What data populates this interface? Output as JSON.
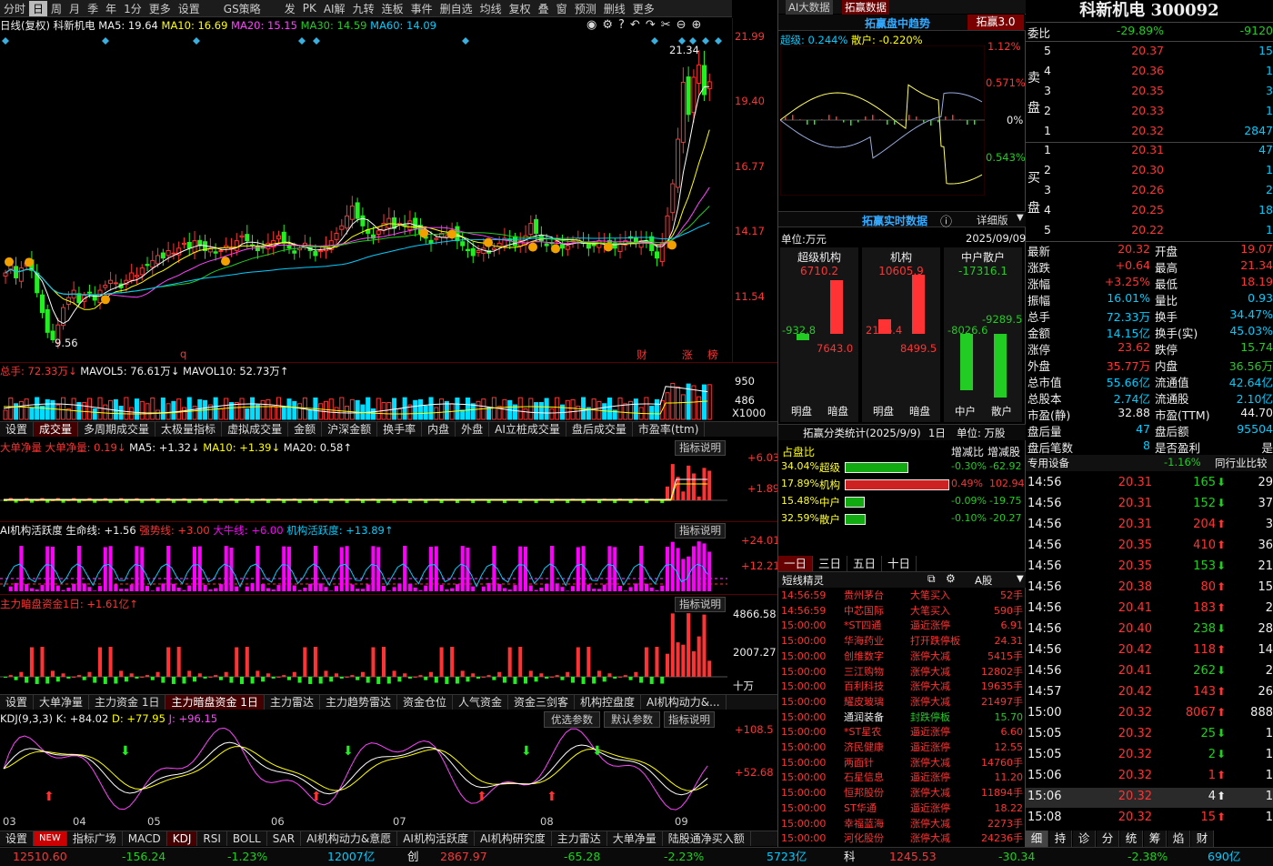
{
  "toolbar": {
    "items": [
      "分时",
      "日",
      "周",
      "月",
      "季",
      "年",
      "1分",
      "更多",
      "设置",
      "GS策略",
      "发",
      "PK",
      "AI解",
      "九转",
      "连板",
      "事件",
      "删自选",
      "均线",
      "复权",
      "叠",
      "窗",
      "预测",
      "删线",
      "更多"
    ],
    "active": "日"
  },
  "chart_header": {
    "mode": "日线(复权)",
    "name": "科新机电",
    "ma5": "MA5: 19.64",
    "ma10": "MA10: 16.69",
    "ma20": "MA20: 15.15",
    "ma30": "MA30: 14.59",
    "ma60": "MA60: 14.09"
  },
  "price_axis": [
    "21.99",
    "19.40",
    "16.77",
    "14.17",
    "11.54"
  ],
  "price_marks": {
    "high": "21.34",
    "low": "9.56",
    "bottom_labels": [
      "q",
      "财",
      "涨",
      "榜"
    ]
  },
  "volume": {
    "header": {
      "total": "总手: 72.33万↓",
      "mavol5": "MAVOL5: 76.61万↓",
      "mavol10": "MAVOL10: 52.73万↑"
    },
    "axis": [
      "950",
      "486",
      "X1000"
    ]
  },
  "tabs1": [
    "设置",
    "成交量",
    "多周期成交量",
    "太极量指标",
    "虚拟成交量",
    "金额",
    "沪深金额",
    "换手率",
    "内盘",
    "外盘",
    "AI立桩成交量",
    "盘后成交量",
    "市盈率(ttm)"
  ],
  "ind1": {
    "title": "大单净量",
    "label": "大单净量: 0.19↓",
    "ma5": "MA5: +1.32↓",
    "ma10": "MA10: +1.39↓",
    "ma20": "MA20: 0.58↑",
    "btn": "指标说明",
    "axis": [
      "+6.03",
      "+1.89"
    ]
  },
  "ind2": {
    "title": "AI机构活跃度",
    "life": "生命线: +1.56",
    "strong": "强势线: +3.00",
    "bull": "大牛线: +6.00",
    "act": "机构活跃度: +13.89↑",
    "btn": "指标说明",
    "axis": [
      "+24.01",
      "+12.21"
    ]
  },
  "ind3": {
    "title": "主力暗盘资金1日: +1.61亿↑",
    "btn": "指标说明",
    "axis": [
      "4866.58",
      "2007.27",
      "十万"
    ]
  },
  "tabs2": [
    "设置",
    "大单净量",
    "主力资金 1日",
    "主力暗盘资金 1日",
    "主力雷达",
    "主力趋势雷达",
    "资金仓位",
    "人气资金",
    "资金三剑客",
    "机构控盘度",
    "AI机构动力&..."
  ],
  "kdj": {
    "label": "KDJ(9,3,3)",
    "k": "K: +84.02",
    "d": "D: +77.95",
    "j": "J: +96.15",
    "btns": [
      "优选参数",
      "默认参数",
      "指标说明"
    ],
    "axis": [
      "+108.5",
      "+52.68"
    ],
    "months": [
      "03",
      "04",
      "05",
      "06",
      "07",
      "08",
      "09"
    ]
  },
  "tabs3": [
    "设置",
    "NEW",
    "指标广场",
    "MACD",
    "KDJ",
    "RSI",
    "BOLL",
    "SAR",
    "AI机构动力&意愿",
    "AI机构活跃度",
    "AI机构研究度",
    "主力雷达",
    "大单净量",
    "陆股通净买入额"
  ],
  "status": {
    "sh": {
      "v": "12510.60",
      "c": "-156.24",
      "p": "-1.23%",
      "a": "12007亿"
    },
    "cy": {
      "n": "创",
      "v": "2867.97",
      "c": "-65.28",
      "p": "-2.23%",
      "a": "5723亿"
    },
    "kc": {
      "n": "科",
      "v": "1245.53",
      "c": "-30.34",
      "p": "-2.38%",
      "a": "690亿"
    }
  },
  "mid": {
    "tabs": [
      "AI大数据",
      "拓赢数据"
    ],
    "trend_title": "拓赢盘中趋势",
    "trend_btn": "拓赢3.0",
    "super": "超级: 0.244%",
    "retail": "散户: -0.220%",
    "axis": [
      "1.12%",
      "0.571%",
      "0%",
      "0.543%"
    ],
    "rt_title": "拓赢实时数据",
    "detail": "详细版",
    "unit": "单位:万元",
    "date": "2025/09/09",
    "cols": [
      {
        "h": "超级机构",
        "v": "6710.2",
        "a": "-932.8",
        "b": "7643.0",
        "l": [
          "明盘",
          "暗盘"
        ]
      },
      {
        "h": "机构",
        "v": "10605.9",
        "a": "2106.4",
        "b": "8499.5",
        "l": [
          "明盘",
          "暗盘"
        ]
      },
      {
        "h": "中户散户",
        "v": "-17316.1",
        "a": "-8026.6",
        "b": "-9289.5",
        "l": [
          "中户",
          "散户"
        ]
      }
    ],
    "stat_title": "拓赢分类统计(2025/9/9)",
    "stat_day": "1日",
    "stat_unit": "单位: 万股",
    "stat_head": [
      "占盘比",
      "增减比",
      "增减股"
    ],
    "stat_rows": [
      {
        "p": "34.04%",
        "n": "超级",
        "r": "-0.30%",
        "s": "-62.92"
      },
      {
        "p": "17.89%",
        "n": "机构",
        "r": "0.49%",
        "s": "102.94"
      },
      {
        "p": "15.48%",
        "n": "中户",
        "r": "-0.09%",
        "s": "-19.75"
      },
      {
        "p": "32.59%",
        "n": "散户",
        "r": "-0.10%",
        "s": "-20.27"
      }
    ],
    "period_tabs": [
      "一日",
      "三日",
      "五日",
      "十日"
    ],
    "short_title": "短线精灵",
    "market": "A股",
    "short": [
      [
        "14:56:59",
        "贵州茅台",
        "大笔买入",
        "52手"
      ],
      [
        "14:56:59",
        "中芯国际",
        "大笔买入",
        "590手"
      ],
      [
        "15:00:00",
        "*ST四通",
        "逼近涨停",
        "6.91"
      ],
      [
        "15:00:00",
        "华海药业",
        "打开跌停板",
        "24.31"
      ],
      [
        "15:00:00",
        "创维数字",
        "涨停大减",
        "5415手"
      ],
      [
        "15:00:00",
        "三江购物",
        "涨停大减",
        "12802手"
      ],
      [
        "15:00:00",
        "百利科技",
        "涨停大减",
        "19635手"
      ],
      [
        "15:00:00",
        "耀皮玻璃",
        "涨停大减",
        "21497手"
      ],
      [
        "15:00:00",
        "通润装备",
        "封跌停板",
        "15.70"
      ],
      [
        "15:00:00",
        "*ST星农",
        "逼近涨停",
        "6.60"
      ],
      [
        "15:00:00",
        "济民健康",
        "逼近涨停",
        "12.55"
      ],
      [
        "15:00:00",
        "两面针",
        "涨停大减",
        "14760手"
      ],
      [
        "15:00:00",
        "石星信息",
        "逼近涨停",
        "11.20"
      ],
      [
        "15:00:00",
        "恒邦股份",
        "涨停大减",
        "11894手"
      ],
      [
        "15:00:00",
        "ST华通",
        "逼近涨停",
        "18.22"
      ],
      [
        "15:00:00",
        "幸福蓝海",
        "涨停大减",
        "2273手"
      ],
      [
        "15:00:00",
        "河化股份",
        "涨停大减",
        "24236手"
      ]
    ]
  },
  "right": {
    "title": "科新机电 300092",
    "webi": {
      "l": "委比",
      "p": "-29.89%",
      "v": "-9120"
    },
    "sell": [
      [
        "5",
        "20.37",
        "15"
      ],
      [
        "4",
        "20.36",
        "1"
      ],
      [
        "3",
        "20.35",
        "3"
      ],
      [
        "2",
        "20.33",
        "1"
      ],
      [
        "1",
        "20.32",
        "2847"
      ]
    ],
    "buy": [
      [
        "1",
        "20.31",
        "47"
      ],
      [
        "2",
        "20.30",
        "1"
      ],
      [
        "3",
        "20.26",
        "2"
      ],
      [
        "4",
        "20.25",
        "18"
      ],
      [
        "5",
        "20.22",
        "1"
      ]
    ],
    "stats": [
      [
        "最新",
        "20.32",
        "开盘",
        "19.07"
      ],
      [
        "涨跌",
        "+0.64",
        "最高",
        "21.34"
      ],
      [
        "涨幅",
        "+3.25%",
        "最低",
        "18.19"
      ],
      [
        "振幅",
        "16.01%",
        "量比",
        "0.93"
      ],
      [
        "总手",
        "72.33万",
        "换手",
        "34.47%"
      ],
      [
        "金额",
        "14.15亿",
        "换手(实)",
        "45.03%"
      ],
      [
        "涨停",
        "23.62",
        "跌停",
        "15.74"
      ],
      [
        "外盘",
        "35.77万",
        "内盘",
        "36.56万"
      ],
      [
        "总市值",
        "55.66亿",
        "流通值",
        "42.64亿"
      ],
      [
        "总股本",
        "2.74亿",
        "流通股",
        "2.10亿"
      ],
      [
        "市盈(静)",
        "32.88",
        "市盈(TTM)",
        "44.70"
      ],
      [
        "盘后量",
        "47",
        "盘后额",
        "95504"
      ],
      [
        "盘后笔数",
        "8",
        "是否盈利",
        "是"
      ]
    ],
    "industry": {
      "n": "专用设备",
      "p": "-1.16%",
      "b": "同行业比较"
    },
    "ticks": [
      [
        "14:56",
        "20.31",
        "165",
        "d",
        "29"
      ],
      [
        "14:56",
        "20.31",
        "152",
        "d",
        "37"
      ],
      [
        "14:56",
        "20.31",
        "204",
        "u",
        "3"
      ],
      [
        "14:56",
        "20.35",
        "410",
        "u",
        "36"
      ],
      [
        "14:56",
        "20.35",
        "153",
        "d",
        "21"
      ],
      [
        "14:56",
        "20.38",
        "80",
        "u",
        "15"
      ],
      [
        "14:56",
        "20.41",
        "183",
        "u",
        "2"
      ],
      [
        "14:56",
        "20.40",
        "238",
        "d",
        "28"
      ],
      [
        "14:56",
        "20.42",
        "118",
        "u",
        "14"
      ],
      [
        "14:56",
        "20.41",
        "262",
        "d",
        "2"
      ],
      [
        "14:57",
        "20.42",
        "143",
        "u",
        "26"
      ],
      [
        "15:00",
        "20.32",
        "8067",
        "u",
        "888"
      ],
      [
        "15:05",
        "20.32",
        "25",
        "d",
        "1"
      ],
      [
        "15:05",
        "20.32",
        "2",
        "d",
        "1"
      ],
      [
        "15:06",
        "20.32",
        "1",
        "u",
        "1"
      ],
      [
        "15:06",
        "20.32",
        "4",
        "u",
        "1"
      ],
      [
        "15:08",
        "20.32",
        "15",
        "u",
        "1"
      ]
    ],
    "btabs": [
      "细",
      "持",
      "诊",
      "分",
      "统",
      "筹",
      "焰",
      "财"
    ]
  },
  "chart_data": {
    "type": "candlestick",
    "title": "科新机电 日线(复权)",
    "ylim": [
      9.0,
      22.3
    ],
    "high": 21.34,
    "low": 9.56,
    "months": [
      "03",
      "04",
      "05",
      "06",
      "07",
      "08",
      "09"
    ],
    "closes": [
      12.6,
      12.9,
      12.4,
      12.8,
      13.0,
      12.7,
      11.8,
      11.0,
      10.2,
      9.9,
      10.5,
      11.2,
      11.6,
      11.9,
      11.4,
      11.7,
      11.8,
      11.5,
      11.9,
      12.1,
      12.3,
      12.2,
      12.0,
      12.3,
      12.6,
      12.5,
      12.8,
      12.9,
      13.1,
      13.3,
      13.2,
      13.5,
      13.4,
      13.6,
      13.8,
      13.6,
      13.9,
      13.7,
      13.5,
      13.6,
      13.4,
      13.5,
      13.7,
      13.6,
      13.9,
      14.1,
      13.9,
      13.7,
      13.5,
      13.6,
      13.8,
      13.9,
      14.1,
      13.8,
      13.6,
      13.4,
      13.6,
      13.8,
      13.5,
      13.3,
      13.5,
      13.7,
      13.9,
      14.2,
      14.5,
      14.9,
      15.3,
      14.8,
      14.5,
      14.2,
      14.0,
      14.3,
      14.6,
      14.8,
      14.4,
      14.6,
      14.5,
      14.7,
      14.4,
      14.2,
      14.0,
      13.8,
      14.0,
      14.2,
      14.1,
      14.3,
      13.9,
      13.7,
      13.5,
      13.3,
      13.5,
      13.6,
      13.4,
      13.6,
      13.8,
      14.0,
      13.9,
      13.7,
      13.9,
      14.1,
      14.6,
      14.2,
      13.9,
      13.7,
      13.8,
      13.9,
      13.6,
      13.7,
      13.9,
      14.0,
      13.8,
      13.6,
      13.7,
      13.9,
      13.8,
      13.7,
      13.6,
      13.8,
      13.9,
      14.0,
      13.8,
      13.9,
      13.9,
      13.5,
      13.2,
      13.8,
      14.9,
      16.2,
      18.0,
      20.3,
      19.0,
      20.5,
      21.0,
      19.8,
      20.32
    ]
  }
}
